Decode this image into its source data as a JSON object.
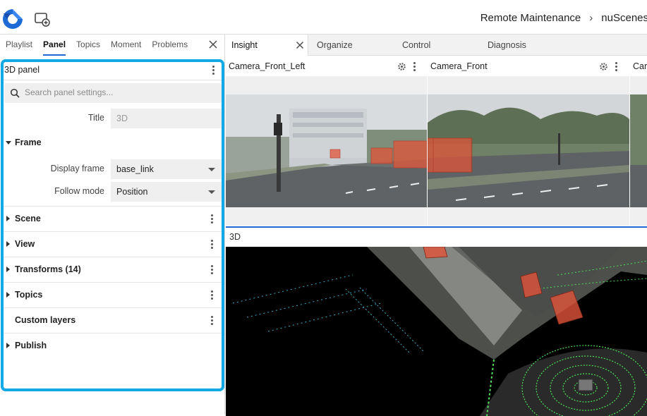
{
  "topbar": {
    "logo_icon": "app-logo-icon",
    "add_panel_icon": "add-panel-icon",
    "breadcrumb": [
      "Remote Maintenance",
      "nuScenes"
    ]
  },
  "left_tabs": {
    "items": [
      "Playlist",
      "Panel",
      "Topics",
      "Moment",
      "Problems"
    ],
    "active": "Panel"
  },
  "panel_settings": {
    "title": "3D panel",
    "search_placeholder": "Search panel settings...",
    "title_label": "Title",
    "title_placeholder": "3D",
    "frame": {
      "label": "Frame",
      "display_frame_label": "Display frame",
      "display_frame_value": "base_link",
      "follow_mode_label": "Follow mode",
      "follow_mode_value": "Position"
    },
    "sections": [
      "Scene",
      "View",
      "Transforms (14)",
      "Topics",
      "Custom layers",
      "Publish"
    ]
  },
  "layout_tabs": {
    "items": [
      "Insight",
      "Organize",
      "Control",
      "Diagnosis"
    ],
    "active": "Insight"
  },
  "cameras": [
    "Camera_Front_Left",
    "Camera_Front",
    "Can"
  ],
  "viewport": {
    "title": "3D"
  },
  "colors": {
    "accent": "#13a9e6",
    "tab_underline": "#1f6bd6",
    "bbox": "#e0543a",
    "lidar_green": "#4ee05a"
  }
}
